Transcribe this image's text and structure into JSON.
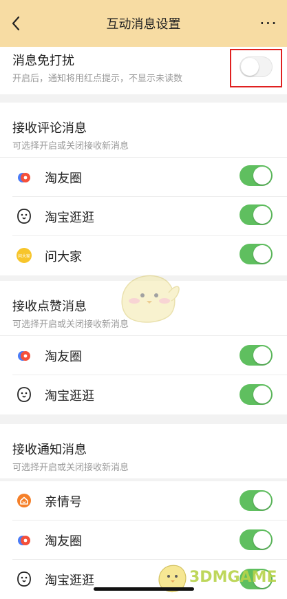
{
  "nav": {
    "title": "互动消息设置",
    "back_icon": "chevron-left-icon",
    "more_label": "···"
  },
  "dnd": {
    "title": "消息免打扰",
    "subtitle": "开启后，通知将用红点提示，不显示未读数",
    "enabled": false
  },
  "sections": [
    {
      "title": "接收评论消息",
      "subtitle": "可选择开启或关闭接收新消息",
      "items": [
        {
          "label": "淘友圈",
          "icon": "taoyouquan-icon",
          "enabled": true
        },
        {
          "label": "淘宝逛逛",
          "icon": "guangguang-icon",
          "enabled": true
        },
        {
          "label": "问大家",
          "icon": "wendajia-icon",
          "icon_text": "问大家",
          "enabled": true
        }
      ]
    },
    {
      "title": "接收点赞消息",
      "subtitle": "可选择开启或关闭接收新消息",
      "items": [
        {
          "label": "淘友圈",
          "icon": "taoyouquan-icon",
          "enabled": true
        },
        {
          "label": "淘宝逛逛",
          "icon": "guangguang-icon",
          "enabled": true
        }
      ]
    },
    {
      "title": "接收通知消息",
      "subtitle": "可选择开启或关闭接收新消息",
      "items": [
        {
          "label": "亲情号",
          "icon": "qinqinghao-icon",
          "enabled": true
        },
        {
          "label": "淘友圈",
          "icon": "taoyouquan-icon",
          "enabled": true
        },
        {
          "label": "淘宝逛逛",
          "icon": "guangguang-icon",
          "enabled": true
        }
      ]
    }
  ],
  "watermark": {
    "text": "3DMGAME"
  },
  "colors": {
    "nav_bg": "#f7dca3",
    "toggle_on": "#5fbf5f",
    "highlight_box": "#e02020"
  }
}
